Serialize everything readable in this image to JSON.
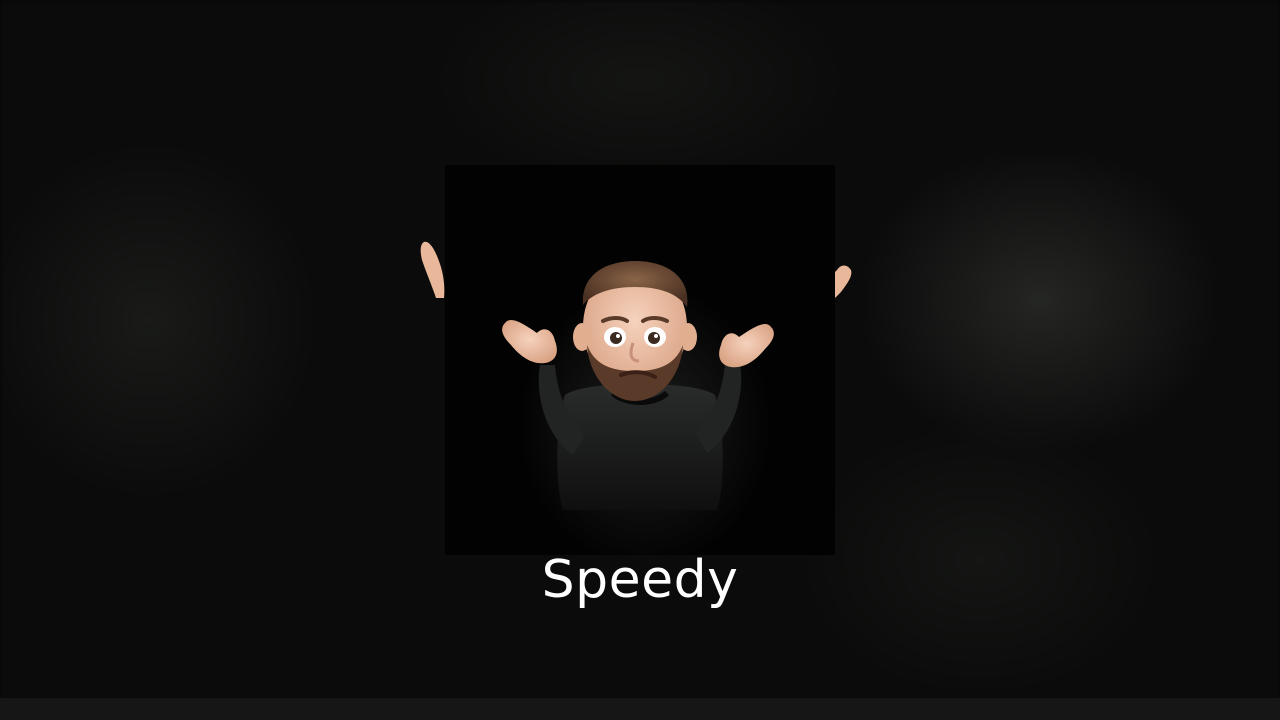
{
  "video": {
    "caption": "Speedy"
  },
  "colors": {
    "background": "#0a0b0a",
    "frame": "#020202",
    "caption_text": "#ffffff",
    "skin": "#efc0a6",
    "hair": "#6b4a35",
    "shirt": "#1e201f"
  },
  "figure": {
    "subject": "memoji-shrug-avatar"
  }
}
